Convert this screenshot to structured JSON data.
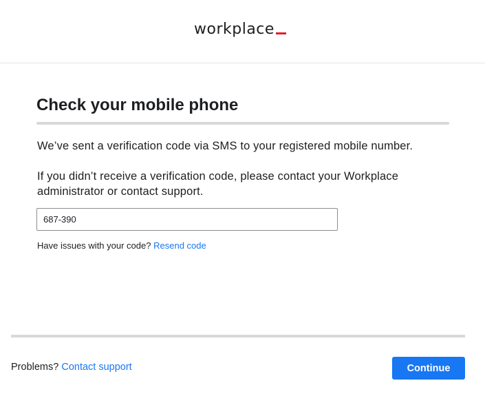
{
  "brand": {
    "logo_text": "workplace",
    "accent_color": "#e41e26"
  },
  "main": {
    "title": "Check your mobile phone",
    "message_sent": "We’ve sent a verification code via SMS to your registered mobile number.",
    "message_help": "If you didn’t receive a verification code, please contact your Workplace administrator or contact support.",
    "code_input": {
      "value": "687-390",
      "placeholder": ""
    },
    "issues_text": "Have issues with your code?",
    "resend_link": "Resend code"
  },
  "footer": {
    "problems_text": "Problems?",
    "contact_link": "Contact support",
    "continue_label": "Continue"
  },
  "colors": {
    "link": "#1877f2",
    "primary_button": "#1877f2",
    "divider": "#d8d8d8",
    "text": "#1c1e21"
  }
}
